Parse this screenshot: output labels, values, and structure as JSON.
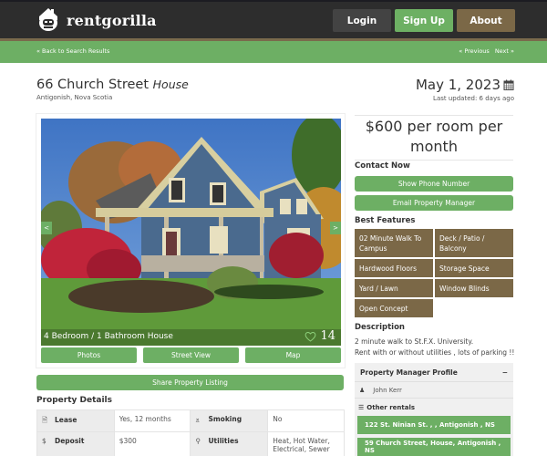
{
  "header": {
    "brand": "rentgorilla",
    "buttons": {
      "login": "Login",
      "signup": "Sign Up",
      "about": "About"
    },
    "colors": {
      "dark": "#2d2d2d",
      "green": "#6daf64",
      "brown": "#7b6847",
      "login": "#434343"
    }
  },
  "nav": {
    "back": "« Back to Search Results",
    "previous": "« Previous",
    "next": "Next »"
  },
  "listing": {
    "street": "66 Church Street",
    "type": "House",
    "location": "Antigonish, Nova Scotia",
    "date": "May 1, 2023",
    "updated": "Last updated: 6 days ago",
    "price": "$600 per room per month"
  },
  "photo": {
    "caption": "4 Bedroom / 1 Bathroom House",
    "likes": "14",
    "prev_arrow": "<",
    "next_arrow": ">",
    "tabs": [
      "Photos",
      "Street View",
      "Map"
    ]
  },
  "share_label": "Share Property Listing",
  "property_details": {
    "title": "Property Details",
    "rows": [
      {
        "k1": "Lease",
        "v1": "Yes, 12 months",
        "k2": "Smoking",
        "v2": "No"
      },
      {
        "k1": "Deposit",
        "v1": "$300",
        "k2": "Utilities",
        "v2": "Heat, Hot Water, Electrical, Sewer"
      }
    ],
    "icons": {
      "lease": "document-icon",
      "smoking": "smoking-icon",
      "deposit": "dollar-icon",
      "utilities": "lightbulb-icon"
    }
  },
  "contact": {
    "title": "Contact Now",
    "show_phone": "Show Phone Number",
    "email": "Email Property Manager"
  },
  "features": {
    "title": "Best Features",
    "items": [
      "02 Minute Walk To Campus",
      "Deck / Patio / Balcony",
      "Hardwood Floors",
      "Storage Space",
      "Yard / Lawn",
      "Window Blinds",
      "Open Concept"
    ]
  },
  "description": {
    "title": "Description",
    "lines": [
      "2 minute walk to St.F.X. University.",
      "Rent with or without utilities , lots of parking !!"
    ]
  },
  "manager": {
    "title": "Property Manager Profile",
    "collapse": "−",
    "name": "John Kerr",
    "other_title": "Other rentals",
    "rentals": [
      "122 St. Ninian St. , , Antigonish , NS",
      "59 Church Street, House, Antigonish , NS"
    ]
  }
}
